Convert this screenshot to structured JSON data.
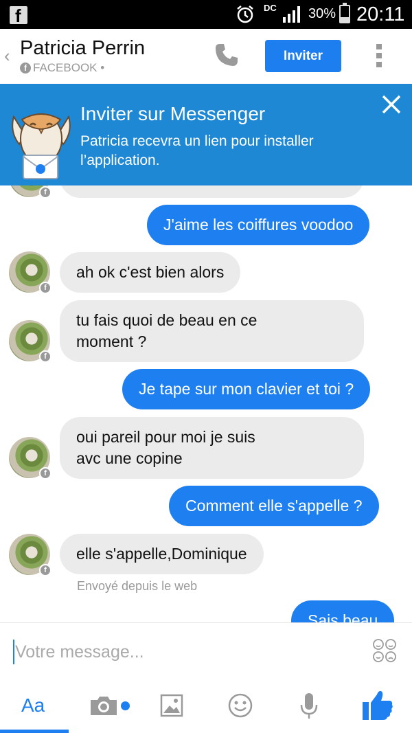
{
  "status_bar": {
    "network_label": "DC",
    "battery": "30%",
    "time": "20:11"
  },
  "header": {
    "contact_name": "Patricia Perrin",
    "source_label": "FACEBOOK •",
    "invite_label": "Inviter"
  },
  "banner": {
    "title": "Inviter sur Messenger",
    "text": "Patricia recevra un lien pour installer l’application."
  },
  "messages": [
    {
      "from": "me",
      "text": "J'aime les coiffures voodoo"
    },
    {
      "from": "them",
      "text": "ah ok c'est bien alors"
    },
    {
      "from": "them",
      "line1": "tu fais quoi de beau en ce",
      "line2": "moment ?"
    },
    {
      "from": "me",
      "text": "Je tape sur mon clavier et toi ?"
    },
    {
      "from": "them",
      "line1": "oui pareil pour moi je suis",
      "line2": "avc une copine"
    },
    {
      "from": "me",
      "text": "Comment elle s'appelle ?"
    },
    {
      "from": "them",
      "text": "elle s'appelle,Dominique",
      "note": "Envoyé depuis le web"
    },
    {
      "from": "me",
      "text": "Sais beau"
    }
  ],
  "composer": {
    "placeholder": "Votre message...",
    "text_tab_label": "Aa"
  },
  "colors": {
    "messenger_blue": "#1e7ff0",
    "banner_blue": "#1e88d5",
    "incoming_bubble": "#ebebeb"
  }
}
